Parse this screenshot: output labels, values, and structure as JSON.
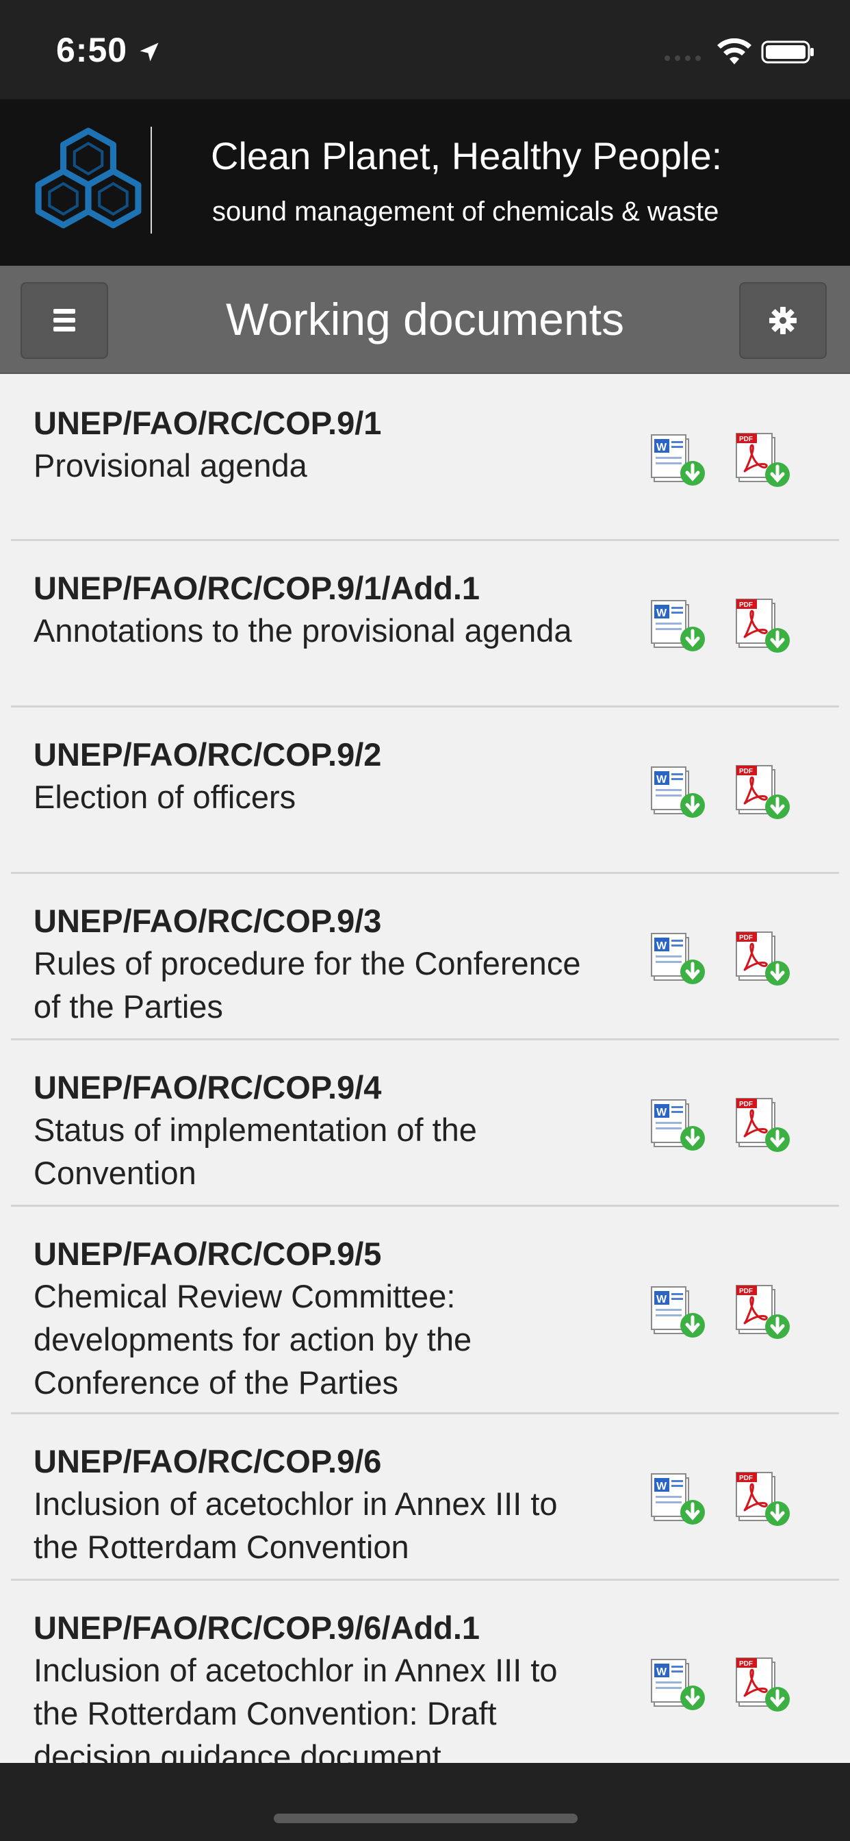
{
  "status_bar": {
    "time": "6:50"
  },
  "header": {
    "title": "Clean Planet, Healthy People:",
    "subtitle": "sound management of chemicals & waste",
    "logo_color": "#1e73b4"
  },
  "nav": {
    "title": "Working documents",
    "menu_icon": "hamburger-icon",
    "settings_icon": "gear-icon"
  },
  "documents": [
    {
      "code": "UNEP/FAO/RC/COP.9/1",
      "title_lines": [
        "Provisional agenda"
      ]
    },
    {
      "code": "UNEP/FAO/RC/COP.9/1/Add.1",
      "title_lines": [
        "Annotations to the provisional agenda"
      ]
    },
    {
      "code": "UNEP/FAO/RC/COP.9/2",
      "title_lines": [
        "Election of officers"
      ]
    },
    {
      "code": "UNEP/FAO/RC/COP.9/3",
      "title_lines": [
        "Rules of procedure for the Conference",
        "of the Parties"
      ]
    },
    {
      "code": "UNEP/FAO/RC/COP.9/4",
      "title_lines": [
        "Status of implementation of the",
        "Convention"
      ]
    },
    {
      "code": "UNEP/FAO/RC/COP.9/5",
      "title_lines": [
        "Chemical Review Committee:",
        "developments for action by the",
        "Conference of the Parties"
      ]
    },
    {
      "code": "UNEP/FAO/RC/COP.9/6",
      "title_lines": [
        "Inclusion of acetochlor in Annex III to",
        "the Rotterdam Convention"
      ]
    },
    {
      "code": "UNEP/FAO/RC/COP.9/6/Add.1",
      "title_lines": [
        "Inclusion of acetochlor in Annex III to",
        "the Rotterdam Convention: Draft",
        "decision guidance document"
      ]
    }
  ],
  "icons": {
    "word": "word-download-icon",
    "pdf": "pdf-download-icon"
  }
}
